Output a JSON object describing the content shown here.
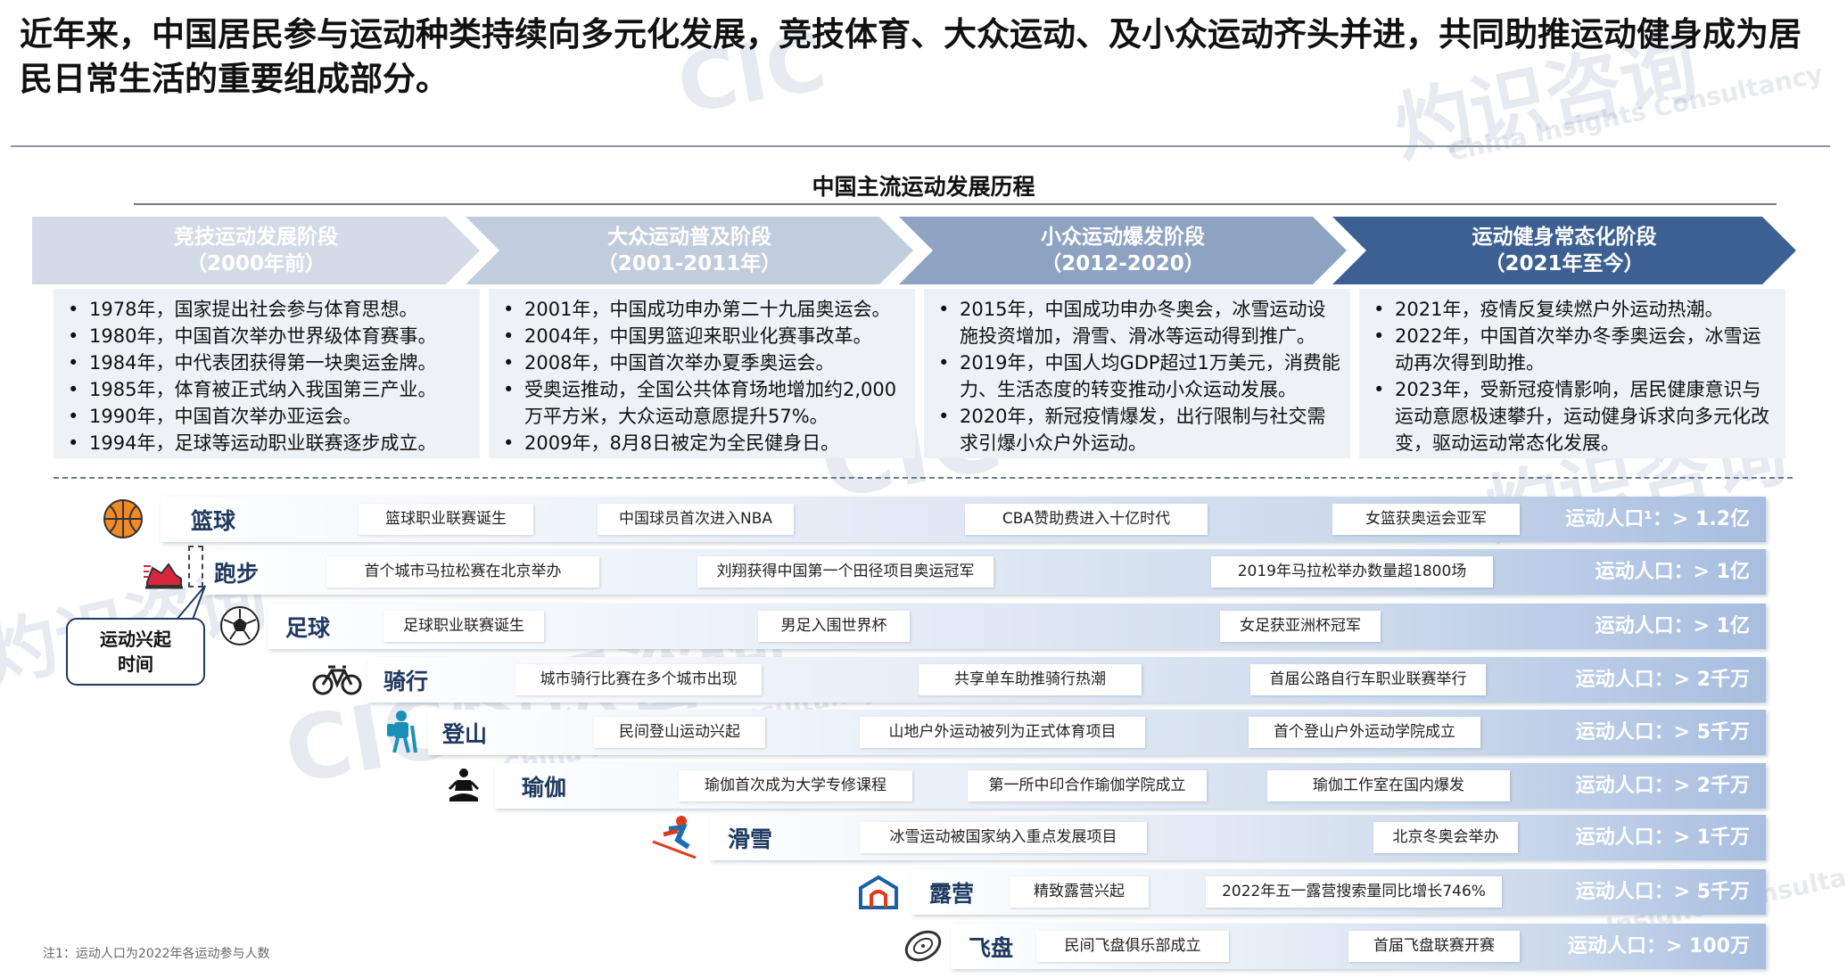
{
  "headline": "近年来，中国居民参与运动种类持续向多元化发展，竞技体育、大众运动、及小众运动齐头并进，共同助推运动健身成为居民日常生活的重要组成部分。",
  "section_title": "中国主流运动发展历程",
  "phases": [
    {
      "name": "竞技运动发展阶段",
      "period": "（2000年前）",
      "color": "#d3dbe6"
    },
    {
      "name": "大众运动普及阶段",
      "period": "（2001-2011年）",
      "color": "#c1cddd"
    },
    {
      "name": "小众运动爆发阶段",
      "period": "（2012-2020）",
      "color": "#8ea3c2"
    },
    {
      "name": "运动健身常态化阶段",
      "period": "（2021年至今）",
      "color": "#3d6092"
    }
  ],
  "descriptions": [
    [
      "1978年，国家提出社会参与体育思想。",
      "1980年，中国首次举办世界级体育赛事。",
      "1984年，中代表团获得第一块奥运金牌。",
      "1985年，体育被正式纳入我国第三产业。",
      "1990年，中国首次举办亚运会。",
      "1994年，足球等运动职业联赛逐步成立。"
    ],
    [
      "2001年，中国成功申办第二十九届奥运会。",
      "2004年，中国男篮迎来职业化赛事改革。",
      "2008年，中国首次举办夏季奥运会。",
      "受奥运推动，全国公共体育场地增加约2,000万平方米，大众运动意愿提升57%。",
      "2009年，8月8日被定为全民健身日。"
    ],
    [
      "2015年，中国成功申办冬奥会，冰雪运动设施投资增加，滑雪、滑冰等运动得到推广。",
      "2019年，中国人均GDP超过1万美元，消费能力、生活态度的转变推动小众运动发展。",
      "2020年，新冠疫情爆发，出行限制与社交需求引爆小众户外运动。"
    ],
    [
      "2021年，疫情反复续燃户外运动热潮。",
      "2022年，中国首次举办冬季奥运会，冰雪运动再次得到助推。",
      "2023年，受新冠疫情影响，居民健康意识与运动意愿极速攀升，运动健身诉求向多元化改变，驱动运动常态化发展。"
    ]
  ],
  "sports": [
    {
      "icon": "basketball-icon",
      "name": "篮球",
      "events": [
        "篮球职业联赛诞生",
        "中国球员首次进入NBA",
        "CBA赞助费进入十亿时代",
        "女篮获奥运会亚军"
      ],
      "population": "运动人口¹：> 1.2亿"
    },
    {
      "icon": "running-shoe-icon",
      "name": "跑步",
      "events": [
        "首个城市马拉松赛在北京举办",
        "刘翔获得中国第一个田径项目奥运冠军",
        "2019年马拉松举办数量超1800场"
      ],
      "population": "运动人口：> 1亿"
    },
    {
      "icon": "soccer-ball-icon",
      "name": "足球",
      "events": [
        "足球职业联赛诞生",
        "男足入围世界杯",
        "女足获亚洲杯冠军"
      ],
      "population": "运动人口：> 1亿"
    },
    {
      "icon": "bicycle-icon",
      "name": "骑行",
      "events": [
        "城市骑行比赛在多个城市出现",
        "共享单车助推骑行热潮",
        "首届公路自行车职业联赛举行"
      ],
      "population": "运动人口：> 2千万"
    },
    {
      "icon": "hiker-icon",
      "name": "登山",
      "events": [
        "民间登山运动兴起",
        "山地户外运动被列为正式体育项目",
        "首个登山户外运动学院成立"
      ],
      "population": "运动人口：> 5千万"
    },
    {
      "icon": "yoga-icon",
      "name": "瑜伽",
      "events": [
        "瑜伽首次成为大学专修课程",
        "第一所中印合作瑜伽学院成立",
        "瑜伽工作室在国内爆发"
      ],
      "population": "运动人口：> 2千万"
    },
    {
      "icon": "skier-icon",
      "name": "滑雪",
      "events": [
        "冰雪运动被国家纳入重点发展项目",
        "北京冬奥会举办"
      ],
      "population": "运动人口：> 1千万"
    },
    {
      "icon": "tent-icon",
      "name": "露营",
      "events": [
        "精致露营兴起",
        "2022年五一露营搜索量同比增长746%"
      ],
      "population": "运动人口：> 5千万"
    },
    {
      "icon": "frisbee-icon",
      "name": "飞盘",
      "events": [
        "民间飞盘俱乐部成立",
        "首届飞盘联赛开赛"
      ],
      "population": "运动人口：> 100万"
    }
  ],
  "callout": {
    "line1": "运动兴起",
    "line2": "时间"
  },
  "footnote": "注1：运动人口为2022年各运动参与人数",
  "watermarks": [
    "CIC",
    "灼识咨询",
    "China Insights Consultancy"
  ]
}
